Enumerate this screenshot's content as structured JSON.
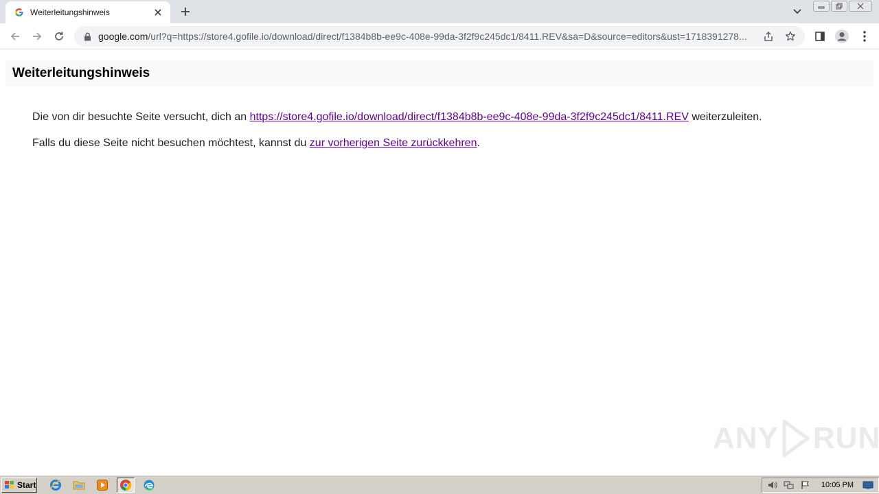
{
  "browser": {
    "tab": {
      "title": "Weiterleitungshinweis"
    },
    "omnibox": {
      "host": "google.com",
      "path": "/url?q=https://store4.gofile.io/download/direct/f1384b8b-ee9c-408e-99da-3f2f9c245dc1/8411.REV&sa=D&source=editors&ust=1718391278..."
    }
  },
  "page": {
    "title": "Weiterleitungshinweis",
    "para1_before": "Die von dir besuchte Seite versucht, dich an ",
    "para1_link": "https://store4.gofile.io/download/direct/f1384b8b-ee9c-408e-99da-3f2f9c245dc1/8411.REV",
    "para1_after": " weiterzuleiten.",
    "para2_before": "Falls du diese Seite nicht besuchen möchtest, kannst du ",
    "para2_link": "zur vorherigen Seite zurückkehren",
    "para2_after": "."
  },
  "watermark": {
    "text_left": "ANY",
    "text_right": "RUN"
  },
  "taskbar": {
    "start_label": "Start",
    "clock": "10:05 PM"
  },
  "colors": {
    "link_visited": "#660099",
    "tabstrip": "#dee1e6",
    "header_bg": "#f8f9fa"
  }
}
